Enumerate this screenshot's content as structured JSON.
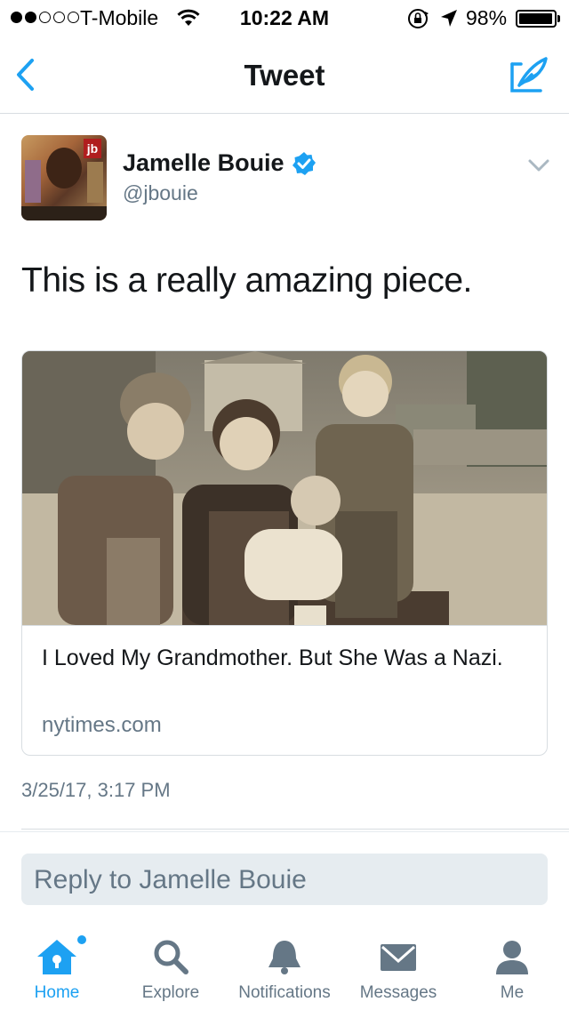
{
  "status_bar": {
    "carrier": "T-Mobile",
    "time": "10:22 AM",
    "battery": "98%",
    "battery_level": 0.98,
    "signal_bars": 2
  },
  "nav": {
    "title": "Tweet",
    "back_icon": "chevron-left-icon",
    "compose_icon": "compose-quill-icon"
  },
  "tweet": {
    "author": {
      "name": "Jamelle Bouie",
      "handle": "@jbouie",
      "verified": true
    },
    "text": "This is a really amazing piece.",
    "card": {
      "title": "I Loved My Grandmother. But She Was a Nazi.",
      "domain": "nytimes.com"
    },
    "timestamp": "3/25/17, 3:17 PM"
  },
  "reply": {
    "placeholder": "Reply to Jamelle Bouie"
  },
  "tabs": [
    {
      "label": "Home",
      "icon": "home-icon",
      "active": true
    },
    {
      "label": "Explore",
      "icon": "search-icon",
      "active": false
    },
    {
      "label": "Notifications",
      "icon": "bell-icon",
      "active": false
    },
    {
      "label": "Messages",
      "icon": "envelope-icon",
      "active": false
    },
    {
      "label": "Me",
      "icon": "person-icon",
      "active": false
    }
  ],
  "colors": {
    "accent": "#1da1f2",
    "secondary_text": "#657786",
    "divider": "#d8dde1",
    "reply_background": "#e6ecf0"
  }
}
